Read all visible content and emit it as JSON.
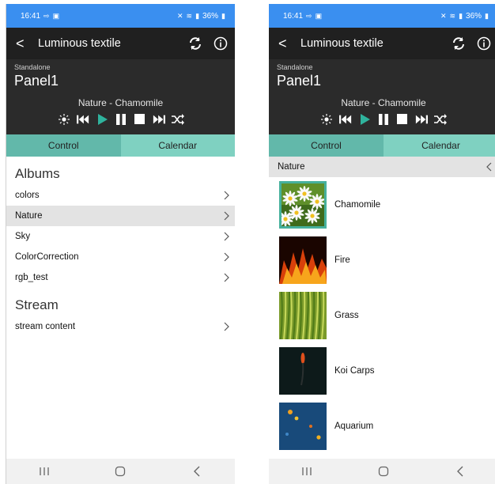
{
  "status": {
    "time": "16:41",
    "battery": "36%"
  },
  "app": {
    "title": "Luminous textile"
  },
  "panel": {
    "label": "Standalone",
    "name": "Panel1",
    "now_playing": "Nature - Chamomile"
  },
  "tabs": {
    "control": "Control",
    "calendar": "Calendar"
  },
  "left": {
    "albums_title": "Albums",
    "albums": [
      {
        "label": "colors",
        "selected": false
      },
      {
        "label": "Nature",
        "selected": true
      },
      {
        "label": "Sky",
        "selected": false
      },
      {
        "label": "ColorCorrection",
        "selected": false
      },
      {
        "label": "rgb_test",
        "selected": false
      }
    ],
    "stream_title": "Stream",
    "stream": [
      {
        "label": "stream content"
      }
    ]
  },
  "right": {
    "breadcrumb": "Nature",
    "items": [
      {
        "label": "Chamomile",
        "thumb": "chamomile",
        "selected": true
      },
      {
        "label": "Fire",
        "thumb": "fire",
        "selected": false
      },
      {
        "label": "Grass",
        "thumb": "grass",
        "selected": false
      },
      {
        "label": "Koi Carps",
        "thumb": "koi",
        "selected": false
      },
      {
        "label": "Aquarium",
        "thumb": "aquarium",
        "selected": false
      }
    ]
  },
  "colors": {
    "statusbar": "#3a8ff0",
    "appbar": "#202020",
    "panel": "#2b2b2b",
    "tab_active": "#62b8aa",
    "tab_inactive": "#7fd1c1",
    "play": "#2fb39d"
  }
}
